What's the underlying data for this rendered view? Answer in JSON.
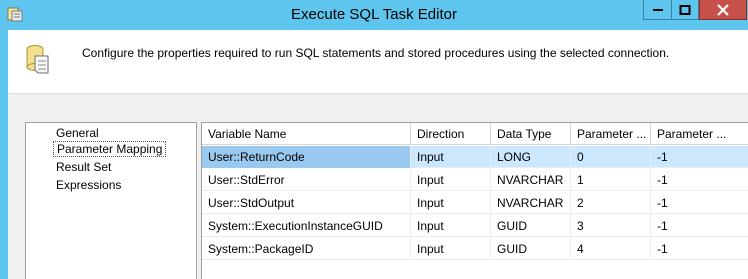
{
  "window": {
    "title": "Execute SQL Task Editor"
  },
  "header": {
    "description": "Configure the properties required to run SQL statements and stored procedures using the selected connection."
  },
  "nav": {
    "items": [
      {
        "label": "General"
      },
      {
        "label": "Parameter Mapping",
        "selected": true
      },
      {
        "label": "Result Set"
      },
      {
        "label": "Expressions"
      }
    ]
  },
  "grid": {
    "columns": [
      "Variable Name",
      "Direction",
      "Data Type",
      "Parameter ...",
      "Parameter ..."
    ],
    "rows": [
      {
        "variable": "User::ReturnCode",
        "direction": "Input",
        "type": "LONG",
        "name": "0",
        "size": "-1",
        "selected": true
      },
      {
        "variable": "User::StdError",
        "direction": "Input",
        "type": "NVARCHAR",
        "name": "1",
        "size": "-1"
      },
      {
        "variable": "User::StdOutput",
        "direction": "Input",
        "type": "NVARCHAR",
        "name": "2",
        "size": "-1"
      },
      {
        "variable": "System::ExecutionInstanceGUID",
        "direction": "Input",
        "type": "GUID",
        "name": "3",
        "size": "-1"
      },
      {
        "variable": "System::PackageID",
        "direction": "Input",
        "type": "GUID",
        "name": "4",
        "size": "-1"
      }
    ]
  },
  "colors": {
    "titlebar": "#5ec5ee",
    "close": "#c7504a",
    "selected_row": "#cce8ff",
    "selected_cell": "#99c9ef"
  },
  "icons": [
    "app-icon",
    "minimize-icon",
    "maximize-icon",
    "close-icon",
    "sql-task-icon"
  ]
}
